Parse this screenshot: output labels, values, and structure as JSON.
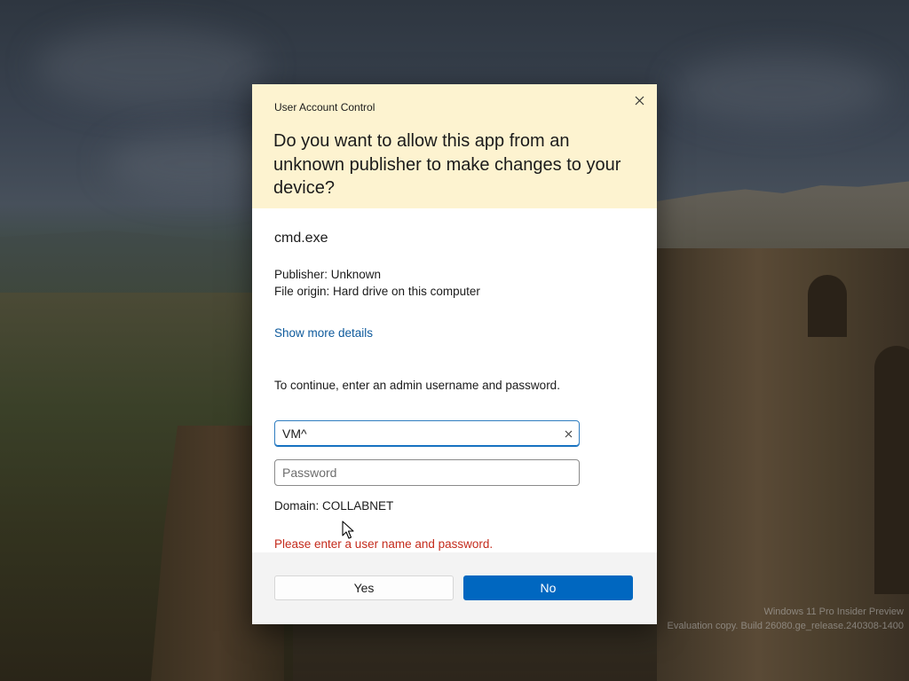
{
  "dialog": {
    "caption": "User Account Control",
    "question": "Do you want to allow this app from an unknown publisher to make changes to your device?",
    "app_name": "cmd.exe",
    "publisher": "Publisher: Unknown",
    "file_origin": "File origin: Hard drive on this computer",
    "show_more_link": "Show more details",
    "instruction": "To continue, enter an admin username and password.",
    "username_value": "VM^",
    "password_placeholder": "Password",
    "domain": "Domain: COLLABNET",
    "error": "Please enter a user name and password.",
    "yes_label": "Yes",
    "no_label": "No"
  },
  "desktop": {
    "watermark_line1": "Windows 11 Pro Insider Preview",
    "watermark_line2": "Evaluation copy. Build 26080.ge_release.240308-1400"
  },
  "colors": {
    "header_bg": "#fdf3d0",
    "accent": "#0067c0",
    "link": "#0e5a9c",
    "error": "#c42b1c"
  },
  "icons": [
    "close-icon",
    "clear-icon",
    "mouse-cursor-icon"
  ]
}
